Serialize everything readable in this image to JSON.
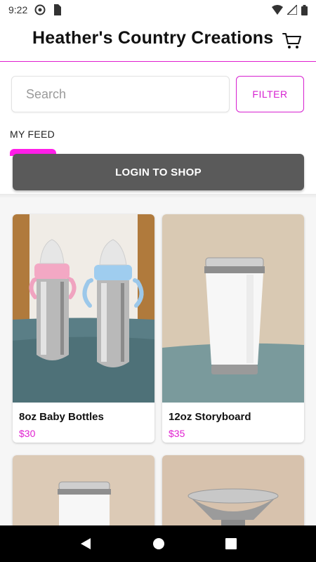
{
  "status_bar": {
    "time": "9:22"
  },
  "header": {
    "title": "Heather's Country Creations"
  },
  "search": {
    "placeholder": "Search"
  },
  "filter_label": "FILTER",
  "feed_label": "MY FEED",
  "login_label": "LOGIN TO SHOP",
  "products": [
    {
      "name": "8oz Baby Bottles",
      "price": "$30"
    },
    {
      "name": "12oz Storyboard",
      "price": "$35"
    }
  ],
  "colors": {
    "accent": "#e020d0",
    "tab": "#ff1ee8",
    "login_button": "#5a5a5a"
  }
}
